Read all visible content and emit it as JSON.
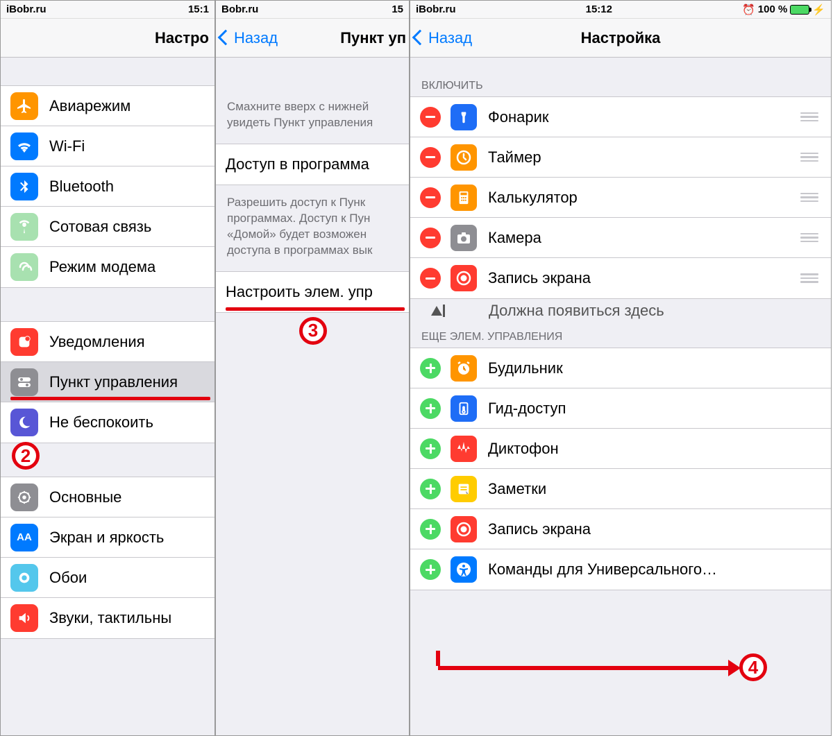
{
  "panel1": {
    "status": {
      "left": "iBobr.ru",
      "time": "15:1"
    },
    "nav_title": "Настро",
    "groups": [
      [
        {
          "label": "Авиарежим",
          "icon": "airplane",
          "bg": "#ff9500"
        },
        {
          "label": "Wi-Fi",
          "icon": "wifi",
          "bg": "#007aff"
        },
        {
          "label": "Bluetooth",
          "icon": "bluetooth",
          "bg": "#007aff"
        },
        {
          "label": "Сотовая связь",
          "icon": "cellular",
          "bg": "#a8e1b0"
        },
        {
          "label": "Режим модема",
          "icon": "hotspot",
          "bg": "#a8e1b0"
        }
      ],
      [
        {
          "label": "Уведомления",
          "icon": "notifications",
          "bg": "#ff3b30"
        },
        {
          "label": "Пункт управления",
          "icon": "control-center",
          "bg": "#8e8e93",
          "highlight": true,
          "selected": true
        },
        {
          "label": "Не беспокоить",
          "icon": "dnd",
          "bg": "#5856d6"
        }
      ],
      [
        {
          "label": "Основные",
          "icon": "general",
          "bg": "#8e8e93"
        },
        {
          "label": "Экран и яркость",
          "icon": "display",
          "bg": "#007aff"
        },
        {
          "label": "Обои",
          "icon": "wallpaper",
          "bg": "#54c7ec"
        },
        {
          "label": "Звуки, тактильны",
          "icon": "sounds",
          "bg": "#ff3b30"
        }
      ]
    ],
    "badge2": "2"
  },
  "panel2": {
    "status": {
      "left": "Bobr.ru",
      "time": "15"
    },
    "nav_back": "Назад",
    "nav_title": "Пункт уп",
    "text1": "Смахните вверх с нижней увидеть Пункт управления",
    "row1": "Доступ в программа",
    "text2": "Разрешить доступ к Пунк программах. Доступ к Пун «Домой» будет возможен доступа в программах вык",
    "row2": "Настроить элем. упр",
    "badge3": "3"
  },
  "panel3": {
    "status": {
      "left": "iBobr.ru",
      "time": "15:12",
      "battery": "100 %"
    },
    "nav_back": "Назад",
    "nav_title": "Настройка",
    "section_include": "ВКЛЮЧИТЬ",
    "include": [
      {
        "label": "Фонарик",
        "bg": "#1e6df6",
        "icon": "flashlight"
      },
      {
        "label": "Таймер",
        "bg": "#ff9500",
        "icon": "timer"
      },
      {
        "label": "Калькулятор",
        "bg": "#ff9500",
        "icon": "calculator"
      },
      {
        "label": "Камера",
        "bg": "#8e8e93",
        "icon": "camera"
      },
      {
        "label": "Запись экрана",
        "bg": "#ff3b30",
        "icon": "record"
      }
    ],
    "annotation": "Должна появиться здесь",
    "section_more": "ЕЩЕ ЭЛЕМ. УПРАВЛЕНИЯ",
    "more": [
      {
        "label": "Будильник",
        "bg": "#ff9500",
        "icon": "alarm"
      },
      {
        "label": "Гид-доступ",
        "bg": "#1e6df6",
        "icon": "guided"
      },
      {
        "label": "Диктофон",
        "bg": "#ff3b30",
        "icon": "voice"
      },
      {
        "label": "Заметки",
        "bg": "#ffcc00",
        "icon": "notes"
      },
      {
        "label": "Запись экрана",
        "bg": "#ff3b30",
        "icon": "record",
        "highlight": true
      },
      {
        "label": "Команды для Универсального…",
        "bg": "#007aff",
        "icon": "accessibility"
      }
    ],
    "badge4": "4"
  }
}
